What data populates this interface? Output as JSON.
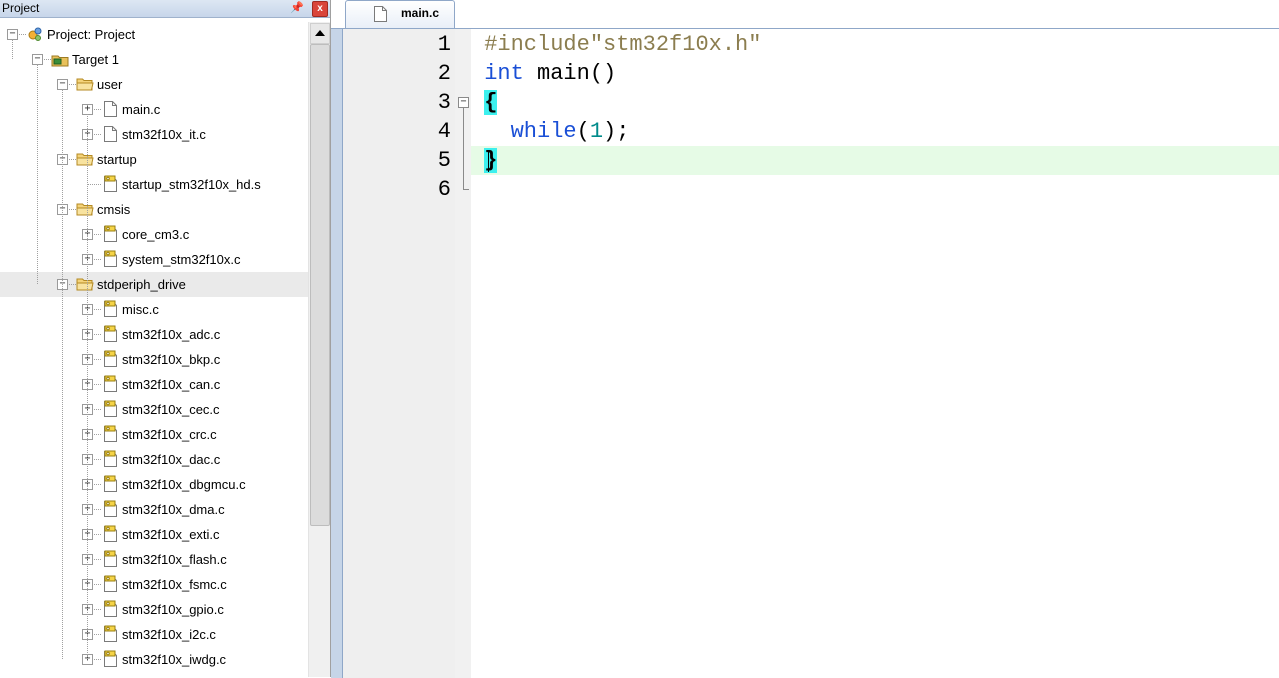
{
  "project_panel": {
    "title": "Project",
    "pin_icon": "pin-icon",
    "close_label": "x"
  },
  "tree": [
    {
      "label": "Project: Project",
      "depth": 0,
      "icon": "project-icon",
      "expander": "minus"
    },
    {
      "label": "Target 1",
      "depth": 1,
      "icon": "target-icon",
      "expander": "minus"
    },
    {
      "label": "user",
      "depth": 2,
      "icon": "folder-icon",
      "expander": "minus"
    },
    {
      "label": "main.c",
      "depth": 3,
      "icon": "file-icon",
      "expander": "plus"
    },
    {
      "label": "stm32f10x_it.c",
      "depth": 3,
      "icon": "file-icon",
      "expander": "plus"
    },
    {
      "label": "startup",
      "depth": 2,
      "icon": "folder-icon",
      "expander": "minus"
    },
    {
      "label": "startup_stm32f10x_hd.s",
      "depth": 3,
      "icon": "key-file-icon",
      "expander": "none"
    },
    {
      "label": "cmsis",
      "depth": 2,
      "icon": "folder-icon",
      "expander": "minus"
    },
    {
      "label": "core_cm3.c",
      "depth": 3,
      "icon": "key-file-icon",
      "expander": "plus"
    },
    {
      "label": "system_stm32f10x.c",
      "depth": 3,
      "icon": "key-file-icon",
      "expander": "plus"
    },
    {
      "label": "stdperiph_drive",
      "depth": 2,
      "icon": "folder-icon",
      "expander": "minus",
      "selected": true
    },
    {
      "label": "misc.c",
      "depth": 3,
      "icon": "key-file-icon",
      "expander": "plus"
    },
    {
      "label": "stm32f10x_adc.c",
      "depth": 3,
      "icon": "key-file-icon",
      "expander": "plus"
    },
    {
      "label": "stm32f10x_bkp.c",
      "depth": 3,
      "icon": "key-file-icon",
      "expander": "plus"
    },
    {
      "label": "stm32f10x_can.c",
      "depth": 3,
      "icon": "key-file-icon",
      "expander": "plus"
    },
    {
      "label": "stm32f10x_cec.c",
      "depth": 3,
      "icon": "key-file-icon",
      "expander": "plus"
    },
    {
      "label": "stm32f10x_crc.c",
      "depth": 3,
      "icon": "key-file-icon",
      "expander": "plus"
    },
    {
      "label": "stm32f10x_dac.c",
      "depth": 3,
      "icon": "key-file-icon",
      "expander": "plus"
    },
    {
      "label": "stm32f10x_dbgmcu.c",
      "depth": 3,
      "icon": "key-file-icon",
      "expander": "plus"
    },
    {
      "label": "stm32f10x_dma.c",
      "depth": 3,
      "icon": "key-file-icon",
      "expander": "plus"
    },
    {
      "label": "stm32f10x_exti.c",
      "depth": 3,
      "icon": "key-file-icon",
      "expander": "plus"
    },
    {
      "label": "stm32f10x_flash.c",
      "depth": 3,
      "icon": "key-file-icon",
      "expander": "plus"
    },
    {
      "label": "stm32f10x_fsmc.c",
      "depth": 3,
      "icon": "key-file-icon",
      "expander": "plus"
    },
    {
      "label": "stm32f10x_gpio.c",
      "depth": 3,
      "icon": "key-file-icon",
      "expander": "plus"
    },
    {
      "label": "stm32f10x_i2c.c",
      "depth": 3,
      "icon": "key-file-icon",
      "expander": "plus"
    },
    {
      "label": "stm32f10x_iwdg.c",
      "depth": 3,
      "icon": "key-file-icon",
      "expander": "plus"
    }
  ],
  "editor": {
    "tab_label": "main.c",
    "tab_icon": "file-icon",
    "current_line": 5,
    "lines": [
      {
        "number": "1",
        "tokens": [
          {
            "t": "#include\"stm32f10x.h\"",
            "c": "pre"
          }
        ]
      },
      {
        "number": "2",
        "tokens": [
          {
            "t": "int",
            "c": "kw"
          },
          {
            "t": " main()",
            "c": "plain"
          }
        ]
      },
      {
        "number": "3",
        "tokens": [
          {
            "t": "{",
            "c": "brace"
          }
        ]
      },
      {
        "number": "4",
        "tokens": [
          {
            "t": "  while",
            "c": "kw"
          },
          {
            "t": "(",
            "c": "plain"
          },
          {
            "t": "1",
            "c": "num"
          },
          {
            "t": ");",
            "c": "plain"
          }
        ]
      },
      {
        "number": "5",
        "tokens": [
          {
            "t": "}",
            "c": "brace"
          }
        ]
      },
      {
        "number": "6",
        "tokens": []
      }
    ]
  },
  "colors": {
    "keyword": "#1a4fd6",
    "preprocessor": "#8b7d4f",
    "number": "#008b8b",
    "brace_highlight": "#3cf0ee",
    "current_line": "#e6fbe6"
  }
}
